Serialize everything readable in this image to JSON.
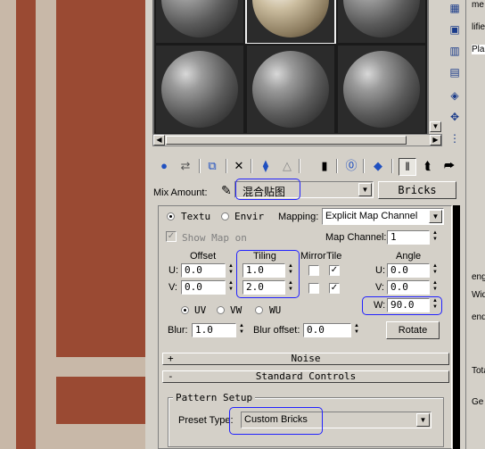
{
  "material_editor": {
    "mix_amount": {
      "label": "Mix Amount:",
      "material_name": "混合贴图",
      "map_type_button": "Bricks"
    },
    "coordinates": {
      "texture_radio": "Textu",
      "environ_radio": "Envir",
      "mapping_label": "Mapping:",
      "mapping_value": "Explicit Map Channel",
      "show_map_on_label": "Show Map on",
      "map_channel_label": "Map Channel:",
      "map_channel_value": "1",
      "offset_header": "Offset",
      "tiling_header": "Tiling",
      "mirror_header": "Mirror",
      "tile_header": "Tile",
      "angle_header": "Angle",
      "u_label": "U:",
      "v_label": "V:",
      "w_label": "W:",
      "offset_u": "0.0",
      "offset_v": "0.0",
      "tiling_u": "1.0",
      "tiling_v": "2.0",
      "angle_u": "0.0",
      "angle_v": "0.0",
      "angle_w": "90.0",
      "uv_radio": "UV",
      "vw_radio": "VW",
      "wu_radio": "WU",
      "blur_label": "Blur:",
      "blur_value": "1.0",
      "blur_offset_label": "Blur offset:",
      "blur_offset_value": "0.0",
      "rotate_button": "Rotate"
    },
    "rollouts": {
      "noise": {
        "sign": "+",
        "title": "Noise"
      },
      "standard_controls": {
        "sign": "-",
        "title": "Standard Controls"
      }
    },
    "pattern_setup": {
      "group_label": "Pattern Setup",
      "preset_type_label": "Preset Type:",
      "preset_type_value": "Custom Bricks"
    },
    "far_right_panel": {
      "items": [
        "me",
        "lifie",
        "Pla",
        "eng",
        "Wid",
        "end",
        "Tota",
        "Ge"
      ]
    },
    "colors": {
      "highlight": "#2222ff",
      "brick": "#9a4a33",
      "mortar": "#c8b8a8"
    }
  }
}
